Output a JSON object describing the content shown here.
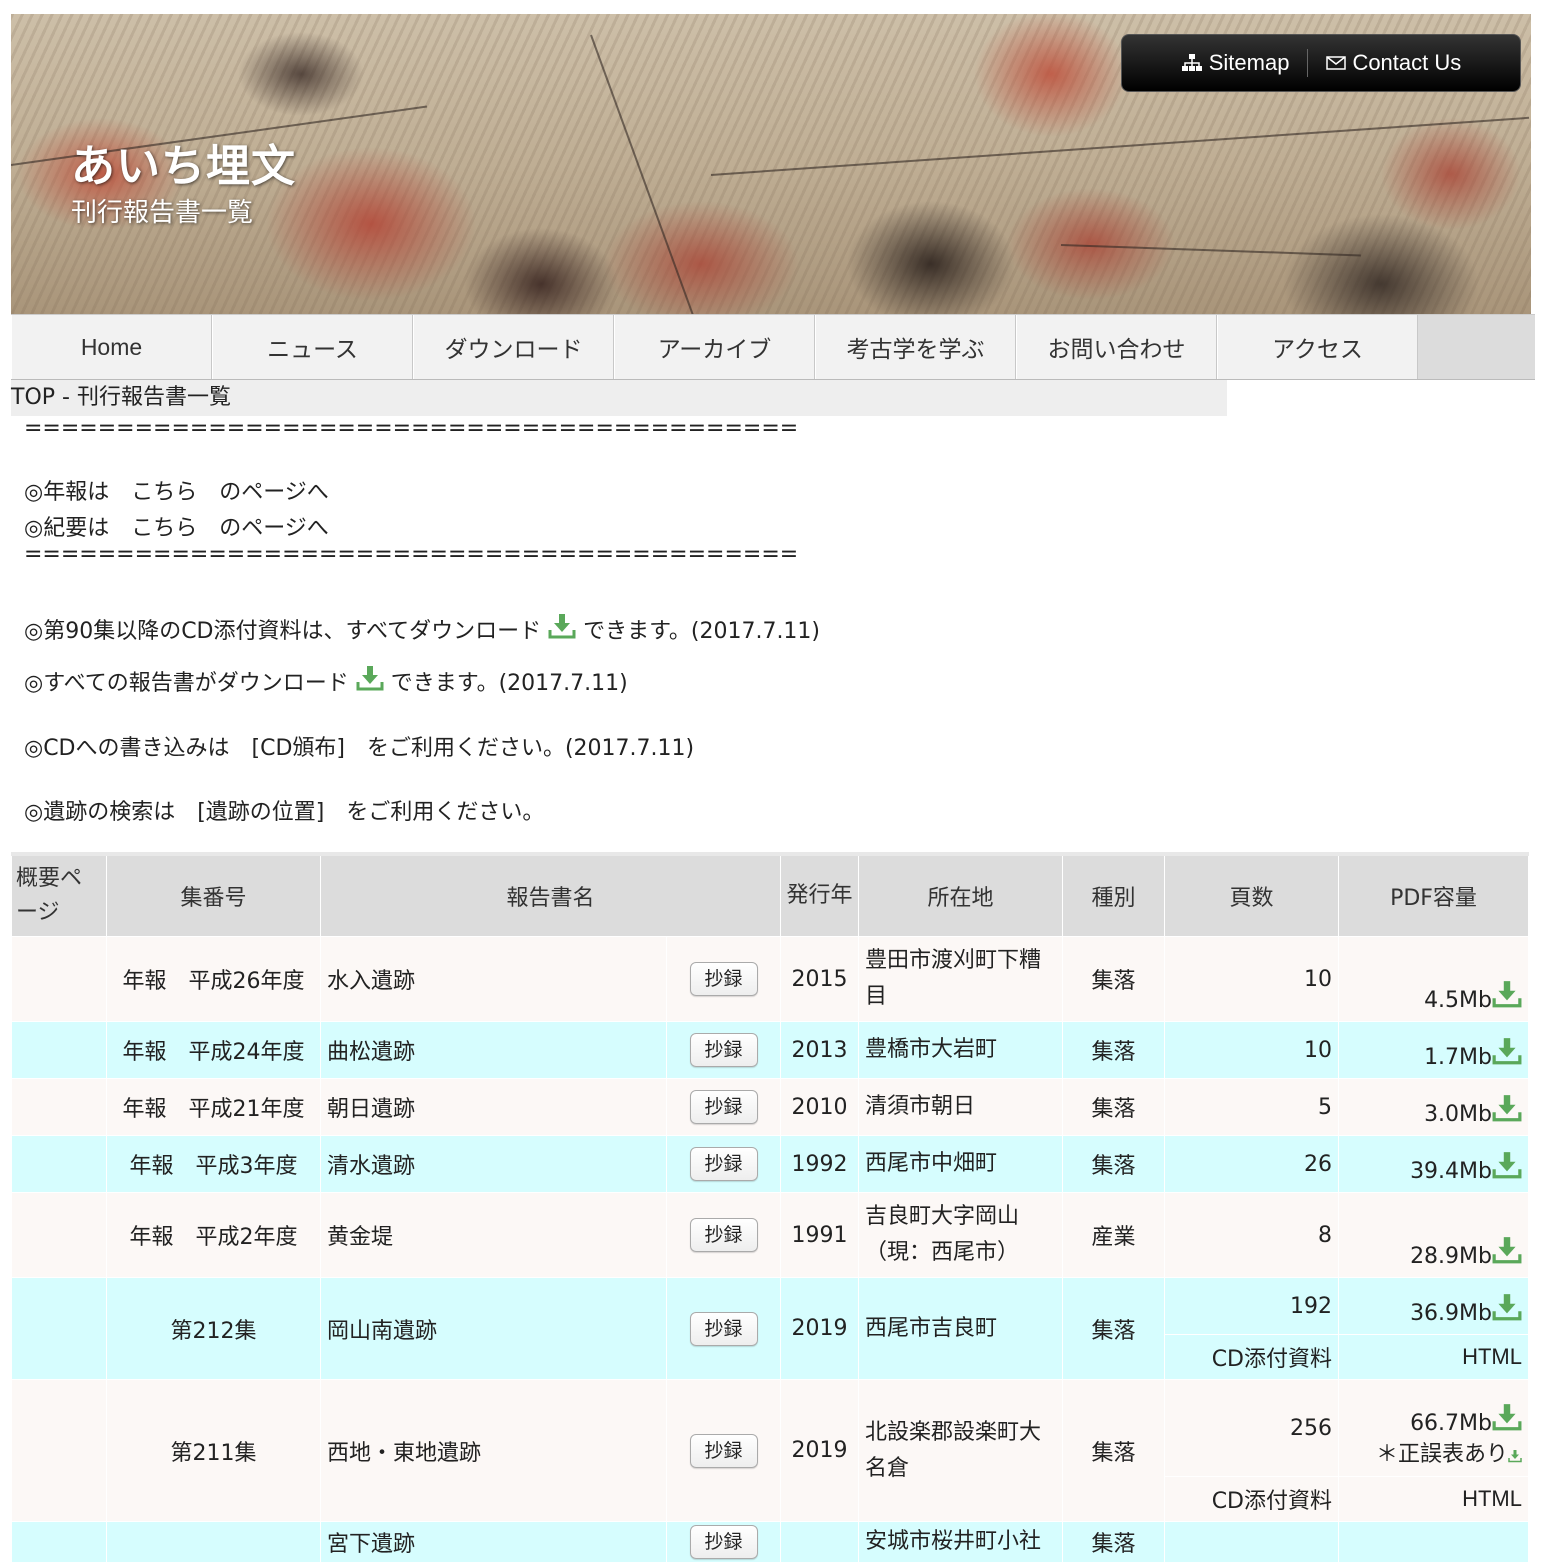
{
  "header": {
    "site_title": "あいち埋文",
    "site_subtitle": "刊行報告書一覧",
    "sitemap": "Sitemap",
    "contact": "Contact Us"
  },
  "nav": [
    "Home",
    "ニュース",
    "ダウンロード",
    "アーカイブ",
    "考古学を学ぶ",
    "お問い合わせ",
    "アクセス"
  ],
  "breadcrumb": "TOP  -  刊行報告書一覧",
  "notes": {
    "rule": "==========================================",
    "nenpo": "◎年報は　こちら　のページへ",
    "kiyo": "◎紀要は　こちら　のページへ",
    "cd_a": "◎第90集以降のCD添付資料は、すべてダウンロード",
    "cd_b": "できます。(2017.7.11)",
    "all_a": "◎すべての報告書がダウンロード",
    "all_b": "できます。(2017.7.11)",
    "cd_write": "◎CDへの書き込みは　[CD頒布]　をご利用ください。(2017.7.11)",
    "search": "◎遺跡の検索は　[遺跡の位置]　をご利用ください。"
  },
  "table": {
    "headers": [
      "概要ページ",
      "集番号",
      "報告書名",
      "発行年",
      "所在地",
      "種別",
      "頁数",
      "PDF容量"
    ],
    "button_label": "抄録",
    "rows": [
      {
        "no": "年報　平成26年度",
        "name": "水入遺跡",
        "year": "2015",
        "loc": "豊田市渡刈町下糟目",
        "type": "集落",
        "pages": "10",
        "pdf": "4.5Mb"
      },
      {
        "no": "年報　平成24年度",
        "name": "曲松遺跡",
        "year": "2013",
        "loc": "豊橋市大岩町",
        "type": "集落",
        "pages": "10",
        "pdf": "1.7Mb"
      },
      {
        "no": "年報　平成21年度",
        "name": "朝日遺跡",
        "year": "2010",
        "loc": "清須市朝日",
        "type": "集落",
        "pages": "5",
        "pdf": "3.0Mb"
      },
      {
        "no": "年報　平成3年度",
        "name": "清水遺跡",
        "year": "1992",
        "loc": "西尾市中畑町",
        "type": "集落",
        "pages": "26",
        "pdf": "39.4Mb"
      },
      {
        "no": "年報　平成2年度",
        "name": "黄金堤",
        "year": "1991",
        "loc1": "吉良町大字岡山",
        "loc2": "（現：西尾市）",
        "type": "産業",
        "pages": "8",
        "pdf": "28.9Mb"
      },
      {
        "no": "第212集",
        "name": "岡山南遺跡",
        "year": "2019",
        "loc": "西尾市吉良町",
        "type": "集落",
        "pages": "192",
        "pdf": "36.9Mb",
        "cd": "CD添付資料",
        "cd_pdf": "HTML"
      },
      {
        "no": "第211集",
        "name": "西地・東地遺跡",
        "year": "2019",
        "loc": "北設楽郡設楽町大名倉",
        "type": "集落",
        "pages": "256",
        "pdf": "66.7Mb",
        "errata": "＊正誤表あり",
        "cd": "CD添付資料",
        "cd_pdf": "HTML"
      },
      {
        "name": "宮下遺跡",
        "loc": "安城市桜井町小社",
        "type": "集落"
      }
    ]
  },
  "colors": {
    "row_odd": "#fcf8f6",
    "row_even": "#d6fdfe",
    "header_bg": "#dcdcdc",
    "download_icon": "#5aa85a"
  }
}
